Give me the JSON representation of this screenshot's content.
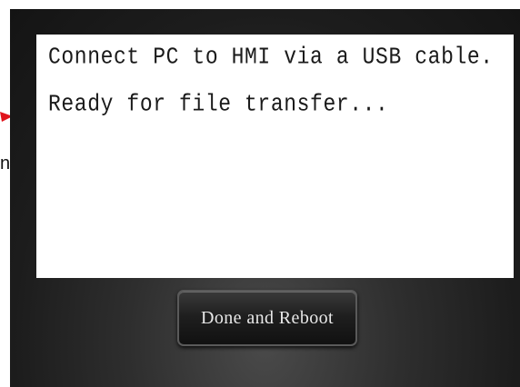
{
  "annotation": {
    "arrow_color": "#e0141c",
    "fragment_text": "n."
  },
  "hmi": {
    "message_lines": [
      "Connect PC to HMI via a USB cable.",
      "Ready for file transfer..."
    ],
    "button_label": "Done and Reboot"
  },
  "colors": {
    "screen_background": "#1c1c1c",
    "panel_background": "#ffffff",
    "message_text": "#1a1a1a",
    "button_text": "#e8e8e8"
  }
}
